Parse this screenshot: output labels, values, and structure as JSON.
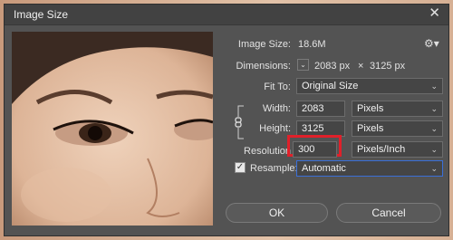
{
  "dialog": {
    "title": "Image Size"
  },
  "image_size": {
    "label": "Image Size:",
    "value": "18.6M"
  },
  "dimensions": {
    "label": "Dimensions:",
    "width": "2083 px",
    "times": "×",
    "height": "3125 px"
  },
  "fit_to": {
    "label": "Fit To:",
    "value": "Original Size"
  },
  "width": {
    "label": "Width:",
    "value": "2083",
    "unit": "Pixels"
  },
  "height": {
    "label": "Height:",
    "value": "3125",
    "unit": "Pixels"
  },
  "resolution": {
    "label": "Resolution",
    "value": "300",
    "unit": "Pixels/Inch"
  },
  "resample": {
    "label": "Resample:",
    "value": "Automatic",
    "checked": true
  },
  "buttons": {
    "ok": "OK",
    "cancel": "Cancel"
  },
  "colors": {
    "dialog_bg": "#535353",
    "titlebar": "#424242",
    "highlight": "#e0202a",
    "accent": "#3a6fd8"
  },
  "icons": {
    "settings": "gear-icon",
    "close": "close-icon",
    "link": "chain-link-icon",
    "dimension_toggle": "chevron-down-icon"
  }
}
